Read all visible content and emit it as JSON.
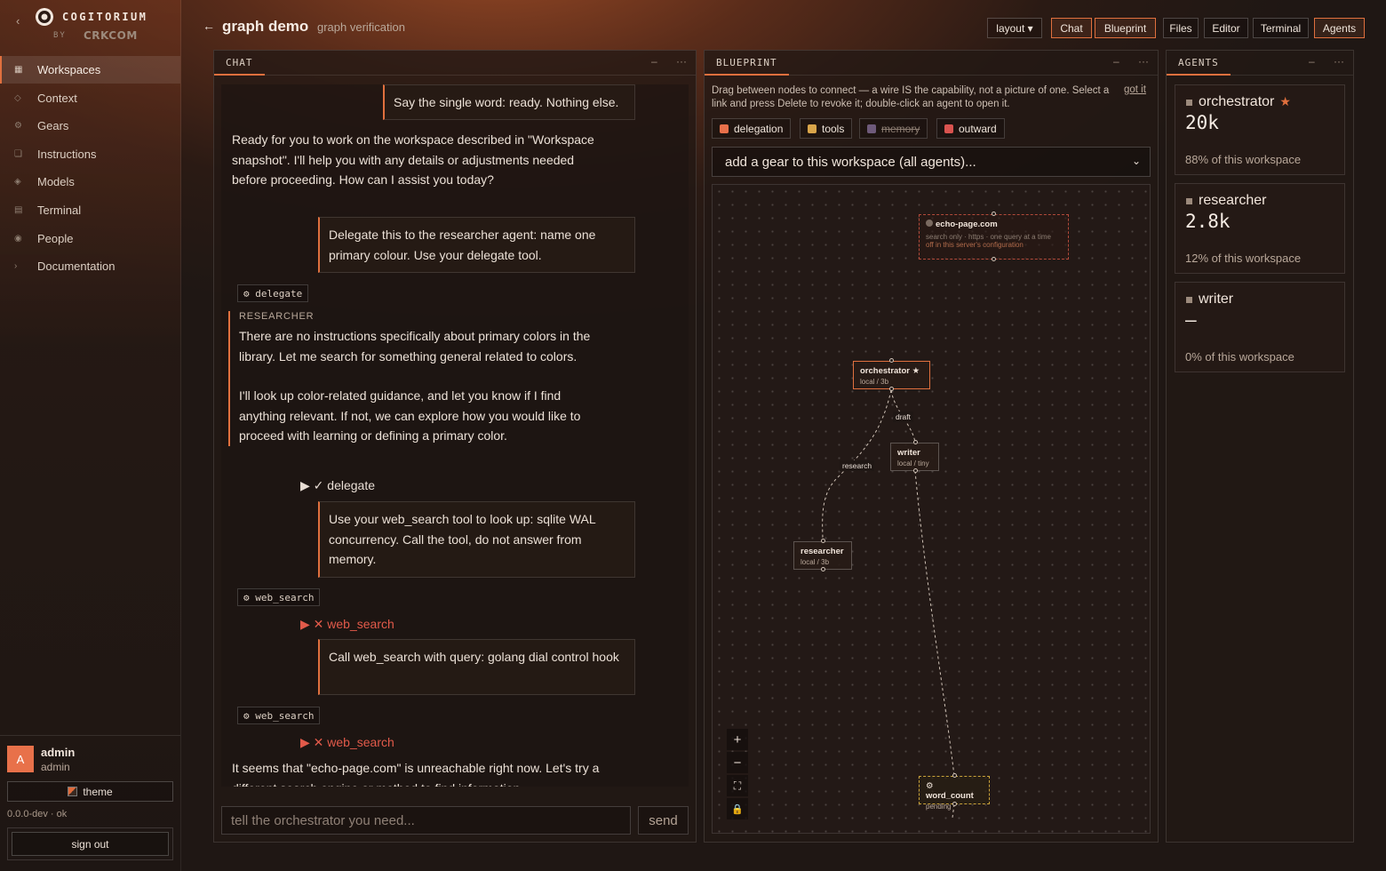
{
  "brand": {
    "name": "COGITORIUM",
    "by": "BY",
    "maker": "CRKCOM"
  },
  "nav": [
    {
      "label": "Workspaces",
      "icon": "grid-icon",
      "glyph": "▦"
    },
    {
      "label": "Context",
      "icon": "diamond-icon",
      "glyph": "◇"
    },
    {
      "label": "Gears",
      "icon": "gear-icon",
      "glyph": "⚙"
    },
    {
      "label": "Instructions",
      "icon": "document-icon",
      "glyph": "❏"
    },
    {
      "label": "Models",
      "icon": "cube-icon",
      "glyph": "◈"
    },
    {
      "label": "Terminal",
      "icon": "terminal-icon",
      "glyph": "▤"
    },
    {
      "label": "People",
      "icon": "person-icon",
      "glyph": "◉"
    },
    {
      "label": "Documentation",
      "icon": "chevron-right-icon",
      "glyph": "›"
    }
  ],
  "user": {
    "initial": "A",
    "name": "admin",
    "role": "admin",
    "theme_label": "theme",
    "version": "0.0.0-dev · ok",
    "signout_label": "sign out"
  },
  "header": {
    "title": "graph demo",
    "subtitle": "graph verification",
    "layout_label": "layout ▾",
    "views": [
      "Chat",
      "Blueprint",
      "Files",
      "Editor",
      "Terminal",
      "Agents"
    ]
  },
  "chat": {
    "tab": "CHAT",
    "messages": {
      "u1": "Say the single word: ready. Nothing else.",
      "a1": "Ready for you to work on the workspace described in \"Workspace snapshot\". I'll help you with any details or adjustments needed before proceeding. How can I assist you today?",
      "u2": "Delegate this to the researcher agent: name one primary colour. Use your delegate tool.",
      "chip1": "⚙ delegate",
      "researcher_label": "RESEARCHER",
      "r1": "There are no instructions specifically about primary colors in the library. Let me search for something general related to colors.",
      "r2": "I'll look up color-related guidance, and let you know if I find anything relevant. If not, we can explore how you would like to proceed with learning or defining a primary color.",
      "tool1": "▶ ✓ delegate",
      "u3": "Use your web_search tool to look up: sqlite WAL concurrency. Call the tool, do not answer from memory.",
      "chip2": "⚙ web_search",
      "tool2": "▶ ✕ web_search",
      "u4": "Call web_search with query: golang dial control hook",
      "chip3": "⚙ web_search",
      "tool3": "▶ ✕ web_search",
      "a2": "It seems that \"echo-page.com\" is unreachable right now. Let's try a different search engine or method to find information."
    },
    "input_placeholder": "tell the orchestrator you need...",
    "send_label": "send"
  },
  "blueprint": {
    "tab": "BLUEPRINT",
    "hint": "Drag between nodes to connect — a wire IS the capability, not a picture of one. Select a link and press Delete to revoke it; double-click an agent to open it.",
    "gotit": "got it",
    "legend": [
      {
        "label": "delegation",
        "color": "#e8704a",
        "enabled": true
      },
      {
        "label": "tools",
        "color": "#d9a54a",
        "enabled": true
      },
      {
        "label": "memory",
        "color": "#6e5a7a",
        "enabled": false
      },
      {
        "label": "outward",
        "color": "#d9534f",
        "enabled": true
      }
    ],
    "gear_select": "add a gear to this workspace (all agents)...",
    "nodes": {
      "echo": {
        "title": "echo-page.com",
        "line1": "search only · https · one query at a time",
        "line2": "off in this server's configuration"
      },
      "orchestrator": {
        "title": "orchestrator ★",
        "sub": "local / 3b"
      },
      "writer": {
        "title": "writer",
        "sub": "local / tiny"
      },
      "researcher": {
        "title": "researcher",
        "sub": "local / 3b"
      },
      "word_count": {
        "title": "⚙ word_count",
        "sub": "pending"
      }
    },
    "edges": {
      "draft": "draft",
      "research": "research"
    },
    "zoom": {
      "in": "+",
      "out": "−",
      "fit": "⛶",
      "lock": "🔒"
    }
  },
  "agents": {
    "tab": "AGENTS",
    "list": [
      {
        "name": "orchestrator",
        "star": "★",
        "tokens": "20k",
        "share": "88% of this workspace"
      },
      {
        "name": "researcher",
        "star": "",
        "tokens": "2.8k",
        "share": "12% of this workspace"
      },
      {
        "name": "writer",
        "star": "",
        "tokens": "—",
        "share": "0% of this workspace"
      }
    ]
  },
  "panel_controls": {
    "minimize": "–",
    "more": "···"
  },
  "colors": {
    "accent": "#e0703e",
    "error": "#e25a4a",
    "bg": "#1f1714"
  }
}
